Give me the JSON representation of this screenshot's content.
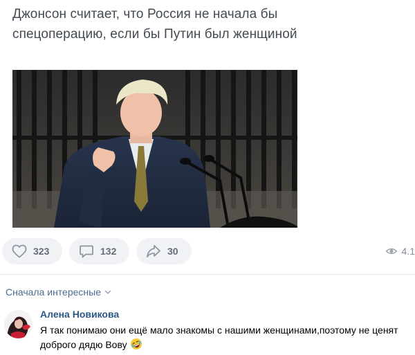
{
  "post": {
    "headline": "Джонсон считает, что Россия не начала бы спецоперацию, если бы Путин был женщиной"
  },
  "actions": {
    "likes": "323",
    "comments": "132",
    "shares": "30",
    "views": "4.1"
  },
  "comments_section": {
    "sort_label": "Сначала интересные",
    "items": [
      {
        "author": "Алена Новикова",
        "text": "Я так понимаю они ещё мало знакомы с нашими женщинами,поэтому не ценят доброго дядю Вову",
        "emoji": "rolling-on-floor-laughing-emoji"
      }
    ]
  },
  "icons": {
    "like": "heart-icon",
    "comment": "comment-bubble-icon",
    "share": "share-arrow-icon",
    "views": "eye-icon",
    "sort": "chevron-down-icon"
  },
  "colors": {
    "pill_bg": "#f0f2f5",
    "pill_text": "#626d7a",
    "link": "#4a6c91",
    "author": "#2a5885"
  }
}
